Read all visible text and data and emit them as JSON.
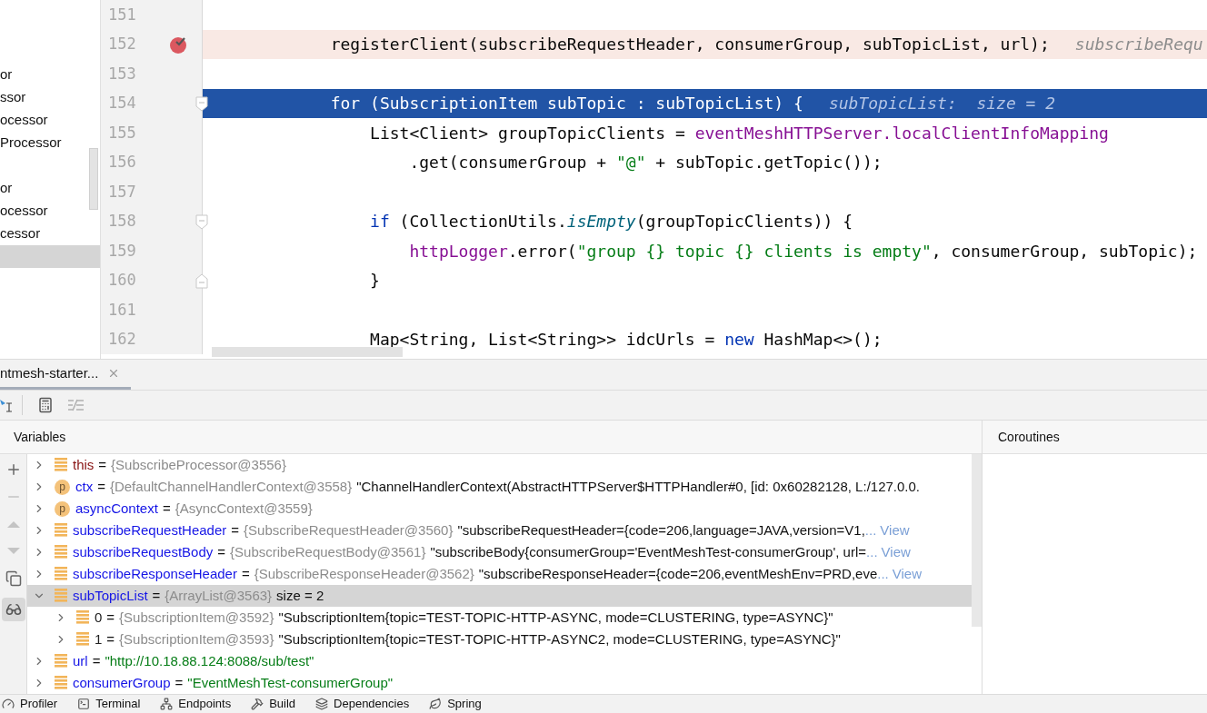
{
  "project_tree": {
    "items": [
      {
        "kind": "row",
        "label": "or",
        "selected": false
      },
      {
        "kind": "row",
        "label": "ssor",
        "selected": false
      },
      {
        "kind": "row",
        "label": "ocessor",
        "selected": false
      },
      {
        "kind": "row",
        "label": "Processor",
        "selected": false
      },
      {
        "kind": "blank"
      },
      {
        "kind": "row",
        "label": "or",
        "selected": false
      },
      {
        "kind": "row",
        "label": "ocessor",
        "selected": false
      },
      {
        "kind": "row",
        "label": "cessor",
        "selected": false
      },
      {
        "kind": "blank",
        "selected": true
      }
    ]
  },
  "editor": {
    "lines": [
      {
        "number": "151",
        "kind": "normal"
      },
      {
        "number": "152",
        "kind": "breakpoint",
        "tokens": [
          {
            "kind": "plain",
            "text": "        registerClient(subscribeRequestHeader, consumerGroup, subTopicList, url);"
          }
        ],
        "hint": "subscribeRequ"
      },
      {
        "number": "153",
        "kind": "normal"
      },
      {
        "number": "154",
        "kind": "current",
        "marker": {
          "kind": "fold-start"
        },
        "tokens": [
          {
            "text": "        for (SubscriptionItem subTopic : subTopicList) {"
          }
        ],
        "hint": "subTopicList:  size = 2"
      },
      {
        "number": "155",
        "kind": "normal",
        "tokens": [
          {
            "kind": "plain",
            "text": "            List<Client> groupTopicClients = "
          },
          {
            "kind": "field",
            "text": "eventMeshHTTPServer.localClientInfoMapping"
          }
        ]
      },
      {
        "number": "156",
        "kind": "normal",
        "tokens": [
          {
            "kind": "plain",
            "text": "                .get(consumerGroup + "
          },
          {
            "kind": "string",
            "text": "\"@\""
          },
          {
            "kind": "plain",
            "text": " + subTopic.getTopic());"
          }
        ]
      },
      {
        "number": "157",
        "kind": "normal"
      },
      {
        "number": "158",
        "kind": "normal",
        "marker": {
          "kind": "fold-start"
        },
        "tokens": [
          {
            "kind": "keyword",
            "text": "            if"
          },
          {
            "kind": "plain",
            "text": " (CollectionUtils."
          },
          {
            "kind": "static",
            "text": "isEmpty"
          },
          {
            "kind": "plain",
            "text": "(groupTopicClients)) {"
          }
        ]
      },
      {
        "number": "159",
        "kind": "normal",
        "tokens": [
          {
            "kind": "field",
            "text": "                httpLogger"
          },
          {
            "kind": "plain",
            "text": ".error("
          },
          {
            "kind": "string",
            "text": "\"group {} topic {} clients is empty\""
          },
          {
            "kind": "plain",
            "text": ", consumerGroup, subTopic);"
          }
        ]
      },
      {
        "number": "160",
        "kind": "normal",
        "marker": {
          "kind": "fold-end"
        },
        "tokens": [
          {
            "kind": "plain",
            "text": "            }"
          }
        ]
      },
      {
        "number": "161",
        "kind": "normal"
      },
      {
        "number": "162",
        "kind": "normal",
        "tokens": [
          {
            "kind": "plain",
            "text": "            Map<String, List<String>> idcUrls = "
          },
          {
            "kind": "keyword",
            "text": "new"
          },
          {
            "kind": "plain",
            "text": " HashMap<>();"
          }
        ]
      }
    ]
  },
  "debug_tab": {
    "label": "ntmesh-starter...",
    "selected": true
  },
  "variables": {
    "title": "Variables",
    "rows": [
      {
        "kind": "this",
        "icon": {
          "kind": "field"
        },
        "name": "this",
        "sign": "=",
        "type": "{SubscribeProcessor@3556}",
        "expanded": false,
        "selected": false
      },
      {
        "kind": "var",
        "icon": {
          "kind": "param",
          "letter": "p"
        },
        "name": "ctx",
        "sign": "=",
        "type": "{DefaultChannelHandlerContext@3558}",
        "value": {
          "kind": "string",
          "text": "\"ChannelHandlerContext(AbstractHTTPServer$HTTPHandler#0, [id: 0x60282128, L:/127.0.0."
        },
        "expanded": false,
        "selected": false
      },
      {
        "kind": "var",
        "icon": {
          "kind": "param",
          "letter": "p"
        },
        "name": "asyncContext",
        "sign": "=",
        "type": "{AsyncContext@3559}",
        "expanded": false,
        "selected": false
      },
      {
        "kind": "var",
        "icon": {
          "kind": "field"
        },
        "name": "subscribeRequestHeader",
        "sign": "=",
        "type": "{SubscribeRequestHeader@3560}",
        "value": {
          "kind": "string",
          "text": "\"subscribeRequestHeader={code=206,language=JAVA,version=V1,"
        },
        "ellipsis": "...",
        "link": "View",
        "expanded": false,
        "selected": false
      },
      {
        "kind": "var",
        "icon": {
          "kind": "field"
        },
        "name": "subscribeRequestBody",
        "sign": "=",
        "type": "{SubscribeRequestBody@3561}",
        "value": {
          "kind": "string",
          "text": "\"subscribeBody{consumerGroup='EventMeshTest-consumerGroup', url="
        },
        "ellipsis": "...",
        "link": "View",
        "expanded": false,
        "selected": false
      },
      {
        "kind": "var",
        "icon": {
          "kind": "field"
        },
        "name": "subscribeResponseHeader",
        "sign": "=",
        "type": "{SubscribeResponseHeader@3562}",
        "value": {
          "kind": "string",
          "text": "\"subscribeResponseHeader={code=206,eventMeshEnv=PRD,eve"
        },
        "ellipsis": "...",
        "link": "View",
        "expanded": false,
        "selected": false
      },
      {
        "kind": "var",
        "icon": {
          "kind": "field"
        },
        "name": "subTopicList",
        "sign": "=",
        "type": "{ArrayList@3563}",
        "value": {
          "kind": "string",
          "text": "size = 2"
        },
        "expanded": true,
        "selected": true,
        "children": [
          {
            "kind": "index",
            "icon": {
              "kind": "field"
            },
            "name": "0",
            "sign": "=",
            "type": "{SubscriptionItem@3592}",
            "value": {
              "kind": "string",
              "text": "\"SubscriptionItem{topic=TEST-TOPIC-HTTP-ASYNC, mode=CLUSTERING, type=ASYNC}\""
            },
            "expanded": false,
            "selected": false
          },
          {
            "kind": "index",
            "icon": {
              "kind": "field"
            },
            "name": "1",
            "sign": "=",
            "type": "{SubscriptionItem@3593}",
            "value": {
              "kind": "string",
              "text": "\"SubscriptionItem{topic=TEST-TOPIC-HTTP-ASYNC2, mode=CLUSTERING, type=ASYNC}\""
            },
            "expanded": false,
            "selected": false
          }
        ]
      },
      {
        "kind": "var",
        "icon": {
          "kind": "field"
        },
        "name": "url",
        "sign": "=",
        "value": {
          "kind": "literal",
          "text": "\"http://10.18.88.124:8088/sub/test\""
        },
        "expanded": false,
        "selected": false
      },
      {
        "kind": "var",
        "icon": {
          "kind": "field"
        },
        "name": "consumerGroup",
        "sign": "=",
        "value": {
          "kind": "literal",
          "text": "\"EventMeshTest-consumerGroup\""
        },
        "expanded": false,
        "selected": false
      }
    ]
  },
  "coroutines": {
    "title": "Coroutines"
  },
  "tool_windows": [
    {
      "kind": "profiler",
      "label": "Profiler"
    },
    {
      "kind": "terminal",
      "label": "Terminal"
    },
    {
      "kind": "endpoints",
      "label": "Endpoints"
    },
    {
      "kind": "build",
      "label": "Build"
    },
    {
      "kind": "dependencies",
      "label": "Dependencies"
    },
    {
      "kind": "spring",
      "label": "Spring"
    }
  ]
}
